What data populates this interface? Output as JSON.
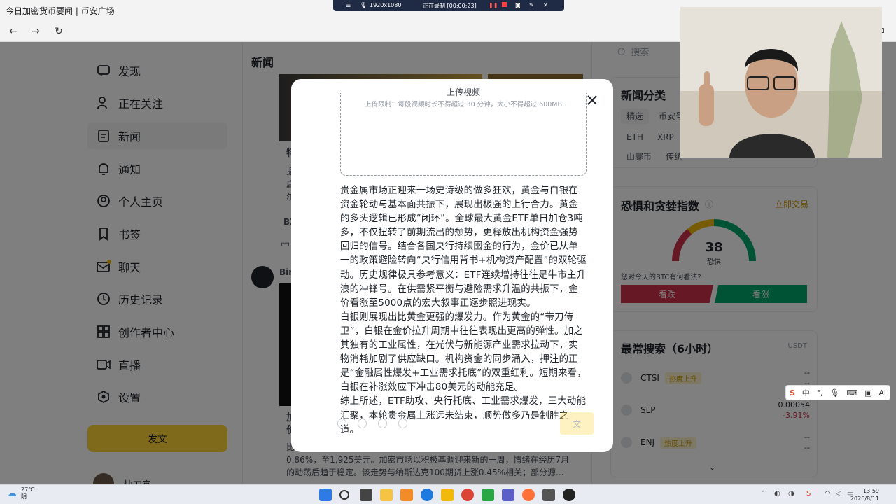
{
  "browser": {
    "window_title": "今日加密货币要闻 | 币安广场",
    "back": "←",
    "forward": "→",
    "reload": "↻"
  },
  "recorder": {
    "resolution": "1920x1080",
    "status": "正在录制 [00:00:23]"
  },
  "sidebar": {
    "items": [
      {
        "label": "发现",
        "icon": "discover-icon"
      },
      {
        "label": "正在关注",
        "icon": "following-icon"
      },
      {
        "label": "新闻",
        "icon": "news-icon"
      },
      {
        "label": "通知",
        "icon": "bell-icon"
      },
      {
        "label": "个人主页",
        "icon": "profile-icon"
      },
      {
        "label": "书签",
        "icon": "bookmark-icon"
      },
      {
        "label": "聊天",
        "icon": "mail-icon"
      },
      {
        "label": "历史记录",
        "icon": "history-icon"
      },
      {
        "label": "创作者中心",
        "icon": "creator-icon"
      },
      {
        "label": "直播",
        "icon": "live-icon"
      },
      {
        "label": "设置",
        "icon": "settings-icon"
      }
    ],
    "active_index": 2,
    "post_button": "发文",
    "user_name": "快刀富"
  },
  "feed": {
    "title": "新闻",
    "fragments": {
      "c1": "特",
      "c2": "据",
      "c3": "启",
      "c4": "尔",
      "bz": "BZ",
      "bin": "Bin",
      "jia": "加",
      "jia2": "价",
      "bi": "比"
    },
    "bottom_line1": "0.86%，至1,925美元。加密市场以积极基调迎来新的一周，情绪在经历7月",
    "bottom_line2": "的动荡后趋于稳定。该走势与纳斯达克100期货上涨0.45%相关；部分源..."
  },
  "right": {
    "search_placeholder": "搜索",
    "news_categories_title": "新闻分类",
    "categories": [
      "精选",
      "币安号",
      "ETH",
      "XRP",
      "山寨币",
      "传统"
    ],
    "fear_greed_title": "恐惧和贪婪指数",
    "trade_now": "立即交易",
    "fear_greed_value": "38",
    "fear_greed_label": "恐惧",
    "fear_greed_fraction": 0.38,
    "btc_question": "您对今天的BTC有何看法?",
    "bearish": "看跌",
    "bullish": "看涨",
    "top_search_title": "最常搜索（6小时）",
    "top_search_unit": "USDT",
    "coins": [
      {
        "symbol": "CTSI",
        "badge": "热度上升",
        "price": "--",
        "change": "--"
      },
      {
        "symbol": "SLP",
        "badge": "",
        "price": "0.00054",
        "change": "-3.91%"
      },
      {
        "symbol": "ENJ",
        "badge": "热度上升",
        "price": "--",
        "change": "--"
      }
    ]
  },
  "modal": {
    "upload_heading": "上传视频",
    "upload_limit": "上传限制：每段视频时长不得超过 30 分钟，大小不得超过 600MB",
    "para1": "贵金属市场正迎来一场史诗级的做多狂欢，黄金与白银在资金轮动与基本面共振下，展现出极强的上行合力。黄金的多头逻辑已形成“闭环”。全球最大黄金ETF单日加仓3吨多，不仅扭转了前期流出的颓势，更释放出机构资金强势回归的信号。结合各国央行持续囤金的行为，金价已从单一的政策避险转向“央行信用背书+机构资产配置”的双轮驱动。历史规律极具参考意义：ETF连续增持往往是牛市主升浪的冲锋号。在供需紧平衡与避险需求升温的共振下，金价看涨至5000点的宏大叙事正逐步照进现实。",
    "para2": "白银则展现出比黄金更强的爆发力。作为黄金的“带刀侍卫”，白银在金价拉升周期中往往表现出更高的弹性。加之其独有的工业属性，在光伏与新能源产业需求拉动下，实物消耗加剧了供应缺口。机构资金的同步涌入，押注的正是“金融属性爆发+工业需求托底”的双重红利。短期来看，白银在补涨效应下冲击80美元的动能充足。",
    "para3": "综上所述，ETF助攻、央行托底、工业需求爆发，三大动能汇聚，本轮贵金属上涨远未结束，顺势做多乃是制胜之道。",
    "publish_ghost": "文"
  },
  "ime": {
    "brand": "S",
    "mode": "中",
    "ai": "Ai"
  },
  "taskbar": {
    "temperature": "27°C",
    "weather": "阴",
    "time": "13:59",
    "date": "2026/8/11"
  },
  "colors": {
    "brand_yellow": "#fcd535",
    "bearish_red": "#cf304a",
    "bullish_green": "#03a66d",
    "text_primary": "#1e2329"
  }
}
